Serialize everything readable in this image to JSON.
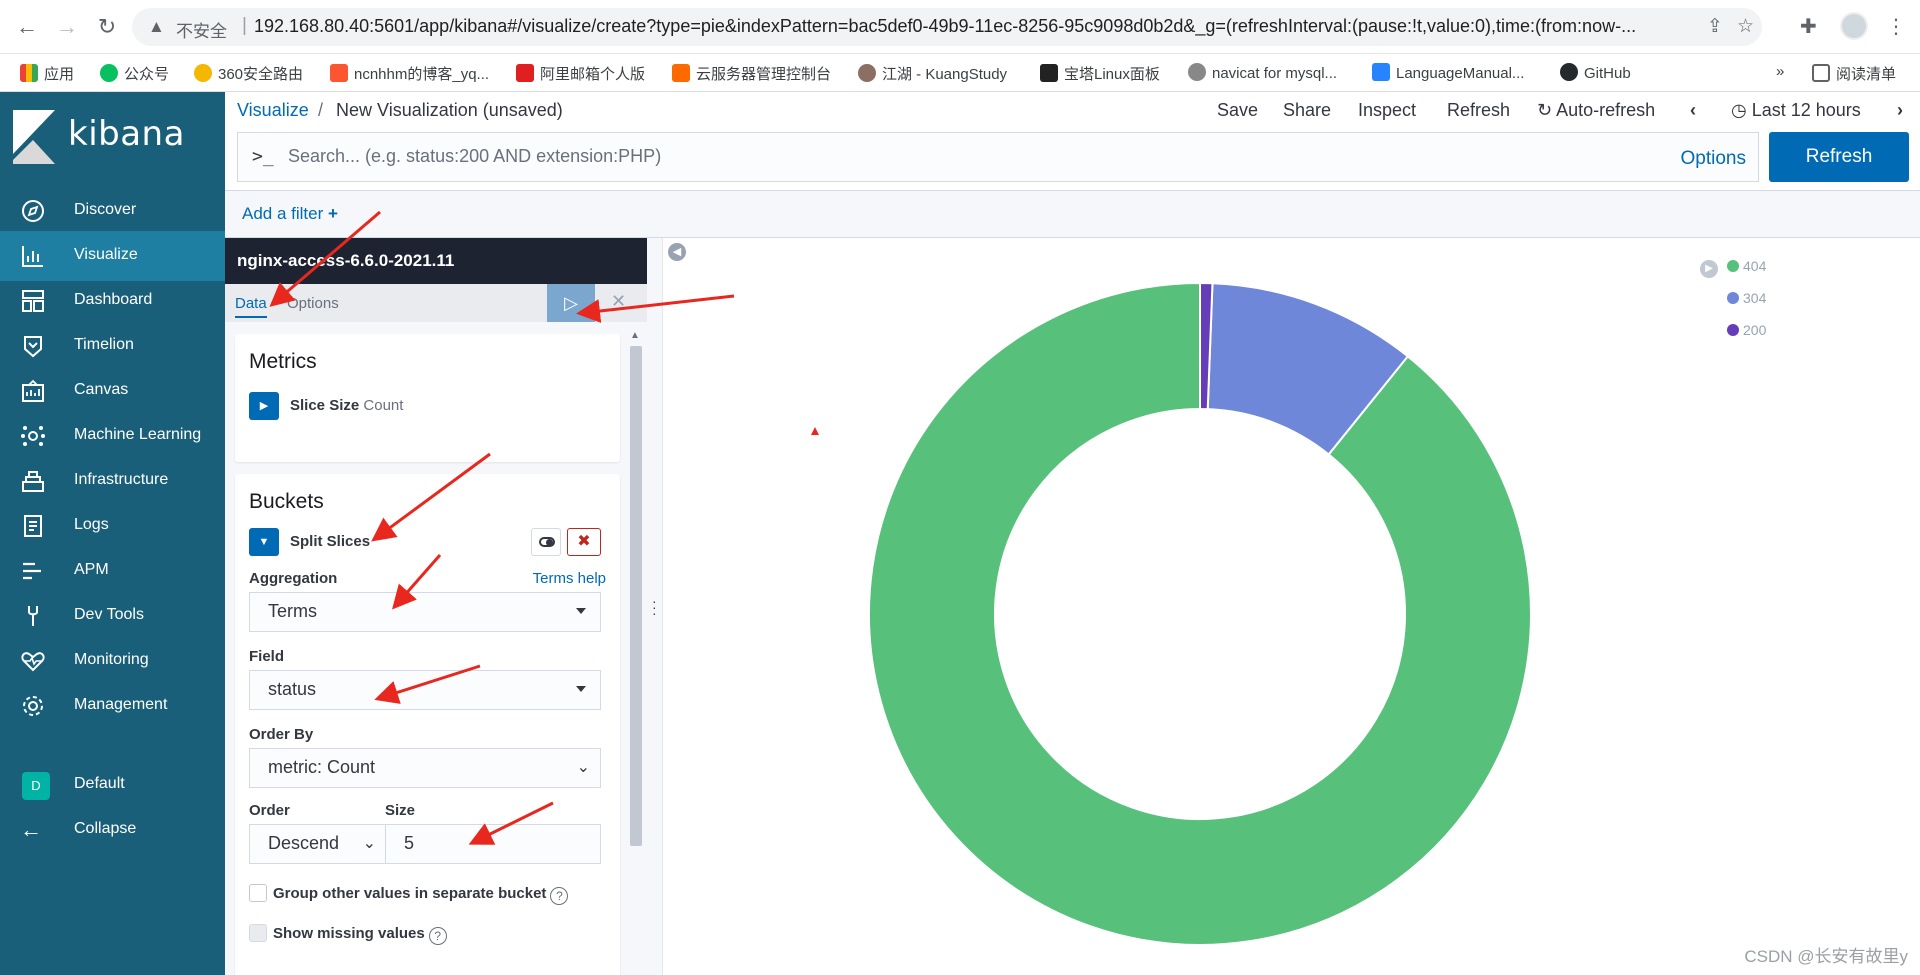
{
  "browser": {
    "insecure_label": "不安全",
    "url": "192.168.80.40:5601/app/kibana#/visualize/create?type=pie&indexPattern=bac5def0-49b9-11ec-8256-95c9098d0b2d&_g=(refreshInterval:(pause:!t,value:0),time:(from:now-...",
    "bookmarks": [
      "应用",
      "公众号",
      "360安全路由",
      "ncnhhm的博客_yq...",
      "阿里邮箱个人版",
      "云服务器管理控制台",
      "江湖 - KuangStudy",
      "宝塔Linux面板",
      "navicat for mysql...",
      "LanguageManual...",
      "GitHub"
    ],
    "more_bookmarks": "»",
    "reading_list": "阅读清单"
  },
  "sidebar": {
    "brand": "kibana",
    "items": [
      {
        "label": "Discover",
        "icon": "compass-icon"
      },
      {
        "label": "Visualize",
        "icon": "visualize-icon"
      },
      {
        "label": "Dashboard",
        "icon": "dashboard-icon"
      },
      {
        "label": "Timelion",
        "icon": "timelion-icon"
      },
      {
        "label": "Canvas",
        "icon": "canvas-icon"
      },
      {
        "label": "Machine Learning",
        "icon": "ml-icon"
      },
      {
        "label": "Infrastructure",
        "icon": "infrastructure-icon"
      },
      {
        "label": "Logs",
        "icon": "logs-icon"
      },
      {
        "label": "APM",
        "icon": "apm-icon"
      },
      {
        "label": "Dev Tools",
        "icon": "wrench-icon"
      },
      {
        "label": "Monitoring",
        "icon": "heartbeat-icon"
      },
      {
        "label": "Management",
        "icon": "gear-icon"
      }
    ],
    "space_badge": "D",
    "space_label": "Default",
    "collapse_label": "Collapse"
  },
  "header": {
    "breadcrumb_root": "Visualize",
    "breadcrumb_sep": "/",
    "breadcrumb_current": "New Visualization (unsaved)",
    "menu": [
      "Save",
      "Share",
      "Inspect",
      "Refresh"
    ],
    "auto_refresh": "Auto-refresh",
    "time_range": "Last 12 hours"
  },
  "query": {
    "prompt": ">_",
    "placeholder": "Search... (e.g. status:200 AND extension:PHP)",
    "options": "Options",
    "refresh": "Refresh"
  },
  "filters": {
    "add_filter": "Add a filter"
  },
  "editor": {
    "index_pattern": "nginx-access-6.6.0-2021.11",
    "tabs": [
      "Data",
      "Options"
    ],
    "apply_icon": "▷",
    "discard_icon": "✕",
    "metrics": {
      "title": "Metrics",
      "agg_name": "Slice Size",
      "agg_type": "Count"
    },
    "buckets": {
      "title": "Buckets",
      "agg_name": "Split Slices",
      "aggregation_label": "Aggregation",
      "help_link": "Terms help",
      "aggregation_value": "Terms",
      "field_label": "Field",
      "field_value": "status",
      "order_by_label": "Order By",
      "order_by_value": "metric: Count",
      "order_label": "Order",
      "order_value": "Descend",
      "size_label": "Size",
      "size_value": "5",
      "group_other": "Group other values in separate bucket",
      "show_missing": "Show missing values"
    }
  },
  "chart_data": {
    "type": "pie",
    "donut": true,
    "categories": [
      "404",
      "304",
      "200"
    ],
    "values": [
      89.2,
      10.2,
      0.6
    ],
    "colors": [
      "#57c17b",
      "#6f87d8",
      "#663db8"
    ],
    "legend_position": "top-right"
  },
  "watermark": "CSDN @长安有故里y"
}
